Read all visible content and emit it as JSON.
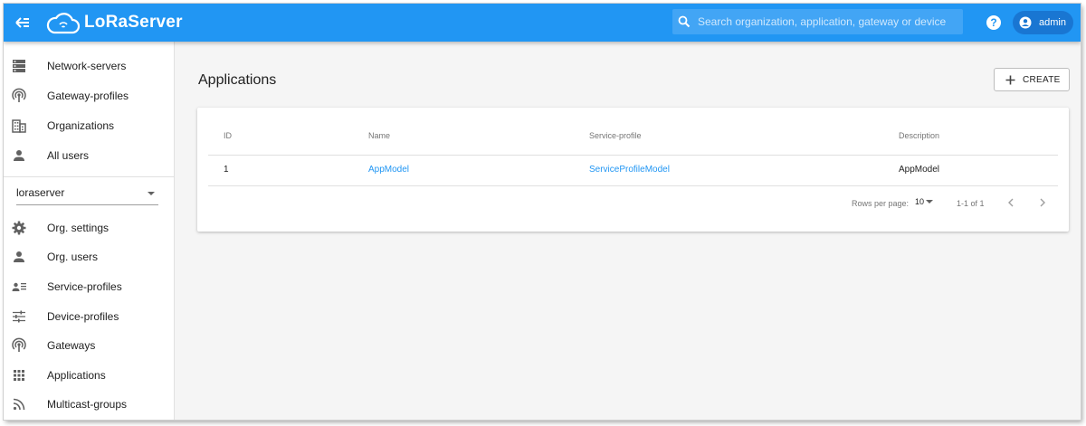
{
  "app": {
    "logo_text": "LoRaServer",
    "colors": {
      "primary": "#2196f3",
      "primary_dark": "#1976d2",
      "link": "#2196f3"
    }
  },
  "topbar": {
    "menu_icon": "menu-collapse-icon",
    "search_placeholder": "Search organization, application, gateway or device",
    "help_icon": "help-icon",
    "user_icon": "account-circle-icon",
    "user_label": "admin"
  },
  "sidebar": {
    "global_items": [
      {
        "label": "Network-servers",
        "icon": "server-icon"
      },
      {
        "label": "Gateway-profiles",
        "icon": "gateway-icon"
      },
      {
        "label": "Organizations",
        "icon": "domain-icon"
      },
      {
        "label": "All users",
        "icon": "person-icon"
      }
    ],
    "org_select": "loraserver",
    "org_items": [
      {
        "label": "Org. settings",
        "icon": "gear-icon"
      },
      {
        "label": "Org. users",
        "icon": "person-icon"
      },
      {
        "label": "Service-profiles",
        "icon": "account-details-icon"
      },
      {
        "label": "Device-profiles",
        "icon": "tune-icon"
      },
      {
        "label": "Gateways",
        "icon": "gateway-icon"
      },
      {
        "label": "Applications",
        "icon": "apps-icon"
      },
      {
        "label": "Multicast-groups",
        "icon": "rss-icon"
      }
    ]
  },
  "main": {
    "title": "Applications",
    "create_label": "CREATE",
    "table": {
      "columns": [
        "ID",
        "Name",
        "Service-profile",
        "Description"
      ],
      "rows": [
        {
          "id": "1",
          "name": "AppModel",
          "service_profile": "ServiceProfileModel",
          "description": "AppModel"
        }
      ]
    },
    "pagination": {
      "rows_per_page_label": "Rows per page:",
      "rows_per_page_value": "10",
      "range": "1-1 of 1"
    }
  }
}
